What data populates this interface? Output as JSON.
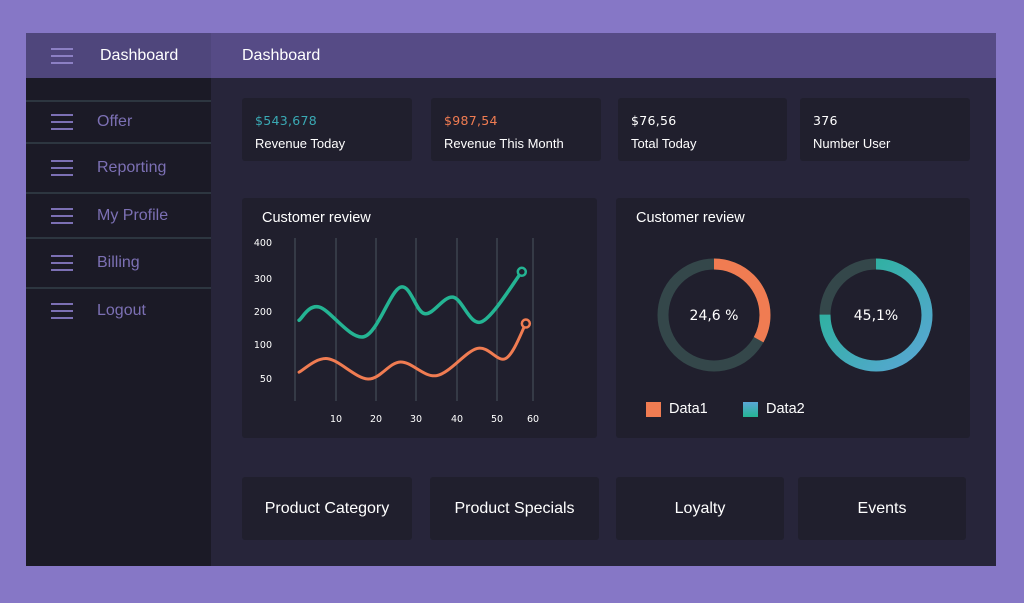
{
  "sidebar": {
    "title": "Dashboard",
    "menu_icon": "hamburger-icon",
    "items": [
      {
        "label": "Offer",
        "icon": "hamburger-icon"
      },
      {
        "label": "Reporting",
        "icon": "hamburger-icon"
      },
      {
        "label": "My Profile",
        "icon": "hamburger-icon"
      },
      {
        "label": "Billing",
        "icon": "hamburger-icon"
      },
      {
        "label": "Logout",
        "icon": "hamburger-icon"
      }
    ]
  },
  "header": {
    "title": "Dashboard"
  },
  "stats": [
    {
      "value": "$543,678",
      "label": "Revenue Today",
      "color": "#2fb59a"
    },
    {
      "value": "$987,54",
      "label": "Revenue This Month",
      "color": "#f07c52"
    },
    {
      "value": "$76,56",
      "label": "Total Today",
      "color": "#ffffff"
    },
    {
      "value": "376",
      "label": "Number User",
      "color": "#ffffff"
    }
  ],
  "line_panel": {
    "title": "Customer review"
  },
  "donut_panel": {
    "title": "Customer review",
    "legend": [
      {
        "label": "Data1",
        "color": "#f07c52"
      },
      {
        "label": "Data2",
        "color": "#2fb59a"
      }
    ]
  },
  "buttons": [
    {
      "label": "Product Category"
    },
    {
      "label": "Product Specials"
    },
    {
      "label": "Loyalty"
    },
    {
      "label": "Events"
    }
  ],
  "colors": {
    "accent_purple": "#564b86",
    "teal": "#24b493",
    "orange": "#f07c52",
    "blue": "#5aa6d6",
    "track": "#34474a"
  },
  "chart_data": [
    {
      "type": "line",
      "title": "Customer review",
      "xlabel": "",
      "ylabel": "",
      "x_ticks": [
        10,
        20,
        30,
        40,
        50,
        60
      ],
      "y_ticks": [
        50,
        100,
        200,
        300,
        400
      ],
      "grid": "vertical",
      "series": [
        {
          "name": "teal-series",
          "color": "#24b493",
          "x": [
            1,
            6,
            17,
            26,
            32,
            39,
            46,
            56
          ],
          "y": [
            175,
            215,
            125,
            275,
            195,
            245,
            170,
            320
          ],
          "end_marker": true
        },
        {
          "name": "orange-series",
          "color": "#f07c52",
          "x": [
            1,
            8,
            18,
            26,
            35,
            45,
            52,
            57
          ],
          "y": [
            60,
            80,
            50,
            75,
            55,
            95,
            80,
            165
          ],
          "end_marker": true
        }
      ]
    },
    {
      "type": "pie",
      "title": "Customer review",
      "donuts": [
        {
          "label": "24,6 %",
          "fill_fraction": 0.33,
          "color": "#f07c52"
        },
        {
          "label": "45,1%",
          "fill_fraction": 0.75,
          "color_start": "#24b493",
          "color_end": "#5aa6d6"
        }
      ]
    }
  ]
}
